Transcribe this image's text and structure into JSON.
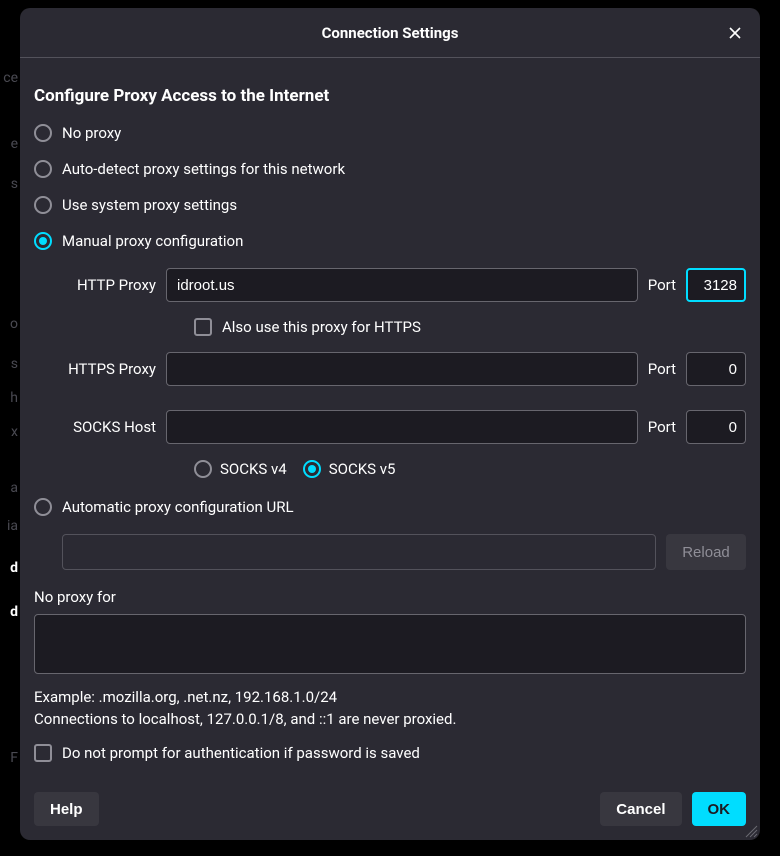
{
  "dialog": {
    "title": "Connection Settings"
  },
  "section": {
    "heading": "Configure Proxy Access to the Internet"
  },
  "modes": {
    "no_proxy": "No proxy",
    "auto_detect": "Auto-detect proxy settings for this network",
    "system": "Use system proxy settings",
    "manual": "Manual proxy configuration",
    "pac": "Automatic proxy configuration URL"
  },
  "manual": {
    "http_label": "HTTP Proxy",
    "http_value": "idroot.us",
    "http_port": "3128",
    "also_https": "Also use this proxy for HTTPS",
    "https_label": "HTTPS Proxy",
    "https_value": "",
    "https_port": "0",
    "socks_label": "SOCKS Host",
    "socks_value": "",
    "socks_port": "0",
    "port_label": "Port",
    "socks_v4": "SOCKS v4",
    "socks_v5": "SOCKS v5"
  },
  "pac": {
    "url_value": "",
    "reload": "Reload"
  },
  "noproxy": {
    "label": "No proxy for",
    "value": "",
    "example": "Example: .mozilla.org, .net.nz, 192.168.1.0/24",
    "note": "Connections to localhost, 127.0.0.1/8, and ::1 are never proxied."
  },
  "auth": {
    "no_prompt": "Do not prompt for authentication if password is saved"
  },
  "buttons": {
    "help": "Help",
    "cancel": "Cancel",
    "ok": "OK"
  }
}
